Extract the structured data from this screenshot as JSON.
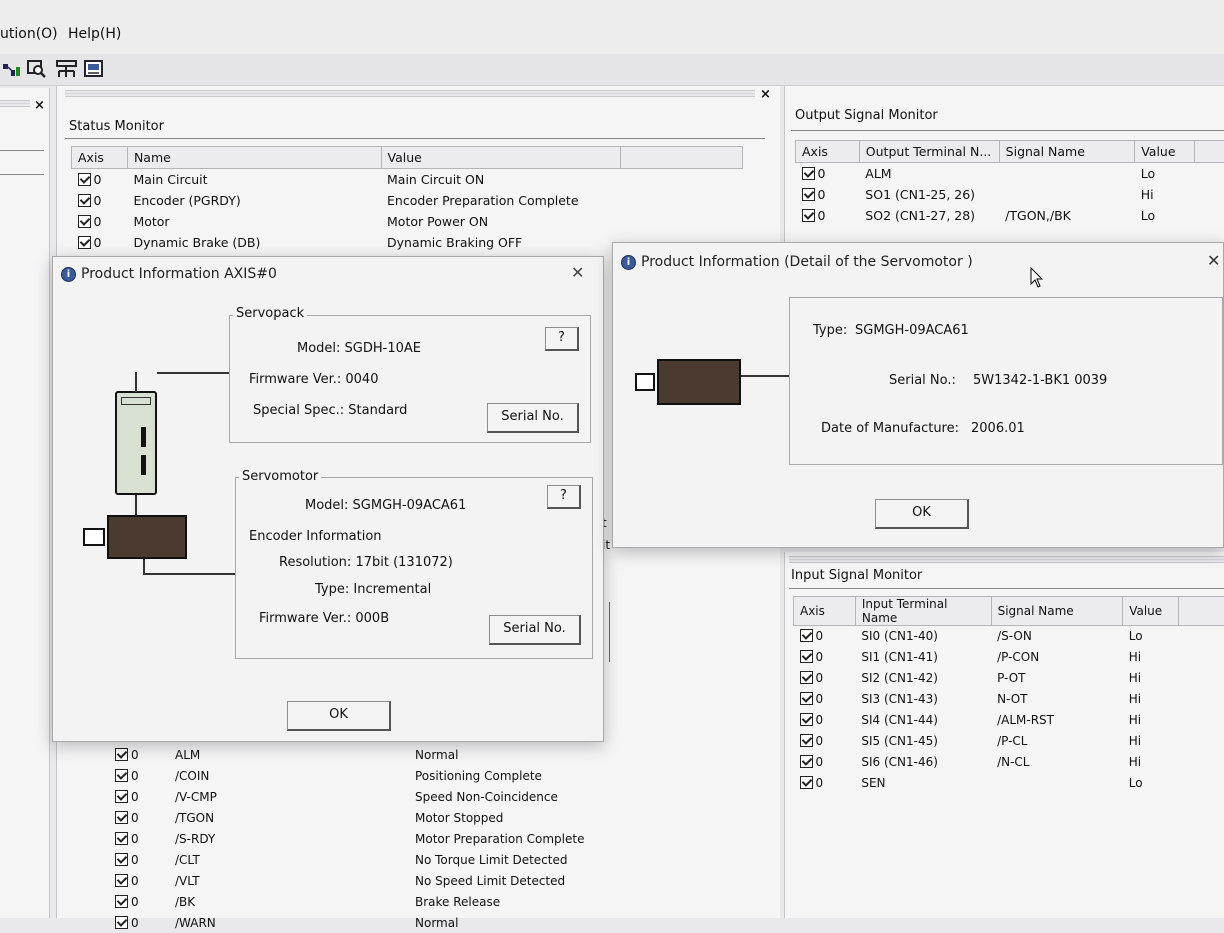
{
  "menu": {
    "items": [
      "ution(O)",
      "Help(H)"
    ]
  },
  "toolbar": {
    "icons": [
      "network-icon",
      "search-icon",
      "tree-icon",
      "monitor-icon"
    ]
  },
  "left_pane": {
    "close": "×"
  },
  "status_monitor": {
    "title": "Status Monitor",
    "close": "×",
    "columns": [
      "Axis",
      "Name",
      "Value"
    ],
    "rows": [
      {
        "axis": "0",
        "name": "Main Circuit",
        "value": "Main Circuit ON"
      },
      {
        "axis": "0",
        "name": "Encoder (PGRDY)",
        "value": "Encoder Preparation Complete"
      },
      {
        "axis": "0",
        "name": "Motor",
        "value": "Motor Power ON"
      },
      {
        "axis": "0",
        "name": "Dynamic Brake (DB)",
        "value": "Dynamic Braking OFF"
      }
    ],
    "fragments": [
      "t",
      "it"
    ],
    "lower_rows": [
      {
        "axis": "0",
        "name": "ALM",
        "value": "Normal"
      },
      {
        "axis": "0",
        "name": "/COIN",
        "value": "Positioning Complete"
      },
      {
        "axis": "0",
        "name": "/V-CMP",
        "value": "Speed Non-Coincidence"
      },
      {
        "axis": "0",
        "name": "/TGON",
        "value": "Motor Stopped"
      },
      {
        "axis": "0",
        "name": "/S-RDY",
        "value": "Motor Preparation Complete"
      },
      {
        "axis": "0",
        "name": "/CLT",
        "value": "No Torque Limit Detected"
      },
      {
        "axis": "0",
        "name": "/VLT",
        "value": "No Speed Limit Detected"
      },
      {
        "axis": "0",
        "name": "/BK",
        "value": "Brake Release"
      },
      {
        "axis": "0",
        "name": "/WARN",
        "value": "Normal"
      }
    ]
  },
  "output_monitor": {
    "title": "Output Signal Monitor",
    "columns": [
      "Axis",
      "Output Terminal N...",
      "Signal Name",
      "Value"
    ],
    "rows": [
      {
        "axis": "0",
        "terminal": "ALM",
        "signal": "",
        "value": "Lo"
      },
      {
        "axis": "0",
        "terminal": "SO1 (CN1-25, 26)",
        "signal": "",
        "value": "Hi"
      },
      {
        "axis": "0",
        "terminal": "SO2 (CN1-27, 28)",
        "signal": "/TGON,/BK",
        "value": "Lo"
      }
    ]
  },
  "input_monitor": {
    "title": "Input Signal Monitor",
    "columns": [
      "Axis",
      "Input Terminal Name",
      "Signal Name",
      "Value"
    ],
    "rows": [
      {
        "axis": "0",
        "terminal": "SI0 (CN1-40)",
        "signal": "/S-ON",
        "value": "Lo"
      },
      {
        "axis": "0",
        "terminal": "SI1 (CN1-41)",
        "signal": "/P-CON",
        "value": "Hi"
      },
      {
        "axis": "0",
        "terminal": "SI2 (CN1-42)",
        "signal": "P-OT",
        "value": "Hi"
      },
      {
        "axis": "0",
        "terminal": "SI3 (CN1-43)",
        "signal": "N-OT",
        "value": "Hi"
      },
      {
        "axis": "0",
        "terminal": "SI4 (CN1-44)",
        "signal": "/ALM-RST",
        "value": "Hi"
      },
      {
        "axis": "0",
        "terminal": "SI5 (CN1-45)",
        "signal": "/P-CL",
        "value": "Hi"
      },
      {
        "axis": "0",
        "terminal": "SI6 (CN1-46)",
        "signal": "/N-CL",
        "value": "Hi"
      },
      {
        "axis": "0",
        "terminal": "SEN",
        "signal": "",
        "value": "Lo"
      }
    ]
  },
  "dialog_axis": {
    "title": "Product Information AXIS#0",
    "close": "✕",
    "servopack": {
      "label": "Servopack",
      "model": "Model: SGDH-10AE",
      "firmware": "Firmware Ver.: 0040",
      "special": "Special Spec.: Standard",
      "help_button": "?",
      "serial_button": "Serial No."
    },
    "servomotor": {
      "label": "Servomotor",
      "model": "Model: SGMGH-09ACA61",
      "encoder_info": "Encoder Information",
      "resolution": "Resolution: 17bit (131072)",
      "type": "Type: Incremental",
      "firmware": "Firmware Ver.: 000B",
      "help_button": "?",
      "serial_button": "Serial No."
    },
    "ok_button": "OK"
  },
  "dialog_motor": {
    "title": "Product Information (Detail of the Servomotor )",
    "close": "✕",
    "type_label": "Type:",
    "type_value": "SGMGH-09ACA61",
    "serial_label": "Serial No.:",
    "serial_value": "5W1342-1-BK1  0039",
    "date_label": "Date of Manufacture:",
    "date_value": "2006.01",
    "ok_button": "OK"
  }
}
